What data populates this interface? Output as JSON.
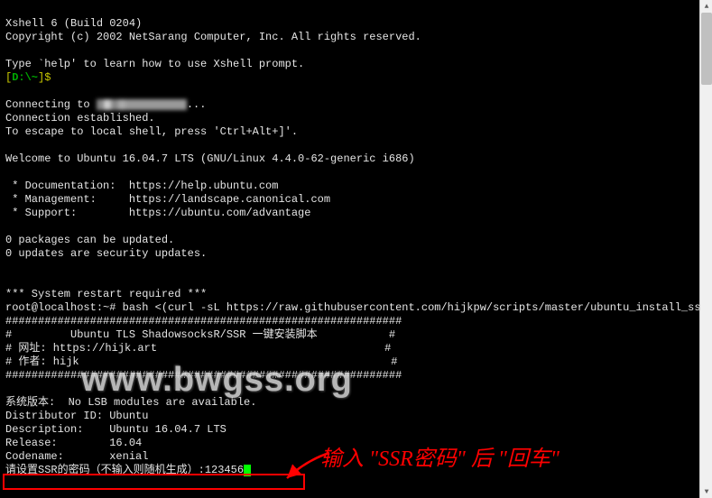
{
  "header": {
    "title": "Xshell 6 (Build 0204)",
    "copyright": "Copyright (c) 2002 NetSarang Computer, Inc. All rights reserved."
  },
  "help_line": "Type `help' to learn how to use Xshell prompt.",
  "local_prompt_pre": "[",
  "local_prompt_path": "D:\\~",
  "local_prompt_post": "]$ ",
  "connect": {
    "connecting_pre": "Connecting to ",
    "connecting_post": "...",
    "established": "Connection established.",
    "escape": "To escape to local shell, press 'Ctrl+Alt+]'."
  },
  "welcome": "Welcome to Ubuntu 16.04.7 LTS (GNU/Linux 4.4.0-62-generic i686)",
  "links": {
    "doc": " * Documentation:  https://help.ubuntu.com",
    "mgmt": " * Management:     https://landscape.canonical.com",
    "support": " * Support:        https://ubuntu.com/advantage"
  },
  "updates": {
    "pkg": "0 packages can be updated.",
    "sec": "0 updates are security updates."
  },
  "restart": "*** System restart required ***",
  "shell_prompt": "root@localhost:~# ",
  "shell_cmd": "bash <(curl -sL https://raw.githubusercontent.com/hijkpw/scripts/master/ubuntu_install_ssr.sh)",
  "banner": {
    "border": "#############################################################",
    "title": "#         Ubuntu TLS ShadowsocksR/SSR 一键安装脚本           #",
    "site": "# 网址: https://hijk.art                                   #",
    "author": "# 作者: hijk                                                #"
  },
  "lsb": {
    "header": "系统版本:  No LSB modules are available.",
    "dist": "Distributor ID:\tUbuntu",
    "desc": "Description:\tUbuntu 16.04.7 LTS",
    "rel": "Release:\t16.04",
    "code": "Codename:\txenial"
  },
  "input": {
    "prompt": "请设置SSR的密码（不输入则随机生成）:",
    "value": "123456"
  },
  "watermark": "www.bwgss.org",
  "annotation": "输入 \"SSR密码\" 后 \"回车\""
}
